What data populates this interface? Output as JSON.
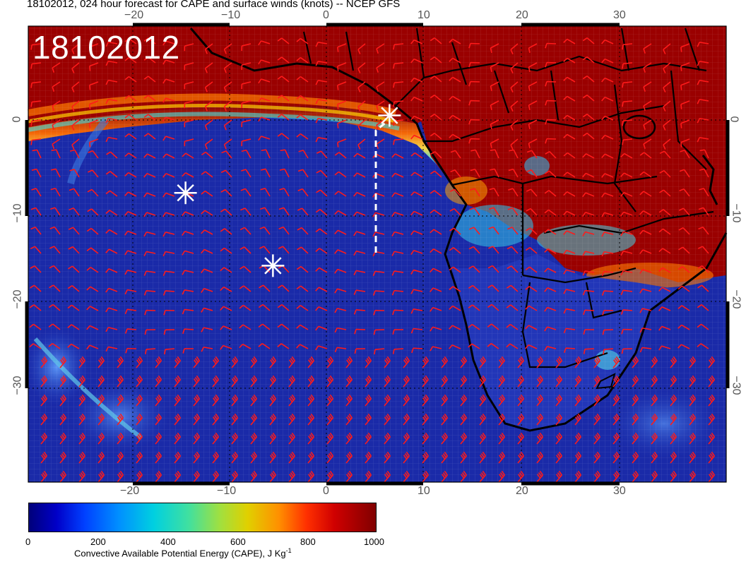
{
  "header": {
    "title": "18102012, 024 hour forecast for CAPE and surface winds (knots) -- NCEP GFS",
    "stamp": "18102012"
  },
  "axes": {
    "lon_labels": [
      "−20",
      "−10",
      "0",
      "10",
      "20",
      "30"
    ],
    "lat_labels": [
      "0",
      "−10",
      "−20",
      "−30"
    ]
  },
  "colorbar": {
    "ticks": [
      "0",
      "200",
      "400",
      "600",
      "800",
      "1000"
    ],
    "label": "Convective Available Potential Energy (CAPE), J Kg",
    "label_sup": "-1"
  },
  "colors": {
    "ocean": "#1a2aa8",
    "land_hot": "#9a0000",
    "barb": "#ff1a1a",
    "marker": "#ffffff"
  },
  "markers": [
    {
      "name": "marker-1",
      "lon": -14.5,
      "lat": -8
    },
    {
      "name": "marker-2",
      "lon": -5.5,
      "lat": -16
    },
    {
      "name": "marker-3",
      "lon": 6.5,
      "lat": 0.5
    }
  ]
}
